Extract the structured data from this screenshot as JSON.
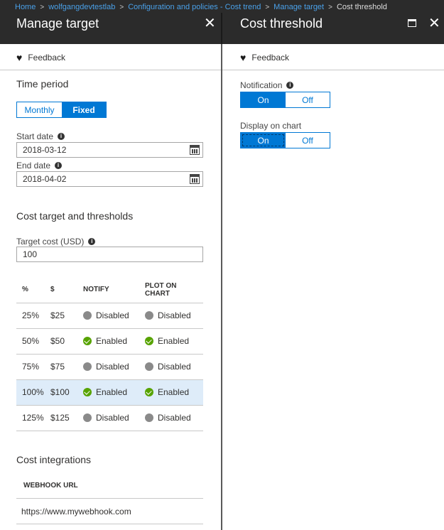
{
  "breadcrumb": {
    "items": [
      "Home",
      "wolfgangdevtestlab",
      "Configuration and policies - Cost trend",
      "Manage target"
    ],
    "current": "Cost threshold",
    "separator": ">"
  },
  "left_blade": {
    "title": "Manage target",
    "close_glyph": "✕",
    "feedback_label": "Feedback",
    "time_period": {
      "heading": "Time period",
      "options": [
        "Monthly",
        "Fixed"
      ],
      "selected": "Fixed"
    },
    "start_date": {
      "label": "Start date",
      "value": "2018-03-12"
    },
    "end_date": {
      "label": "End date",
      "value": "2018-04-02"
    },
    "cost_section_heading": "Cost target and thresholds",
    "target_cost": {
      "label": "Target cost (USD)",
      "value": "100"
    },
    "thresholds_table": {
      "columns": [
        "%",
        "$",
        "NOTIFY",
        "PLOT ON CHART"
      ],
      "rows": [
        {
          "pct": "25%",
          "amount": "$25",
          "notify": "Disabled",
          "plot": "Disabled",
          "selected": false
        },
        {
          "pct": "50%",
          "amount": "$50",
          "notify": "Enabled",
          "plot": "Enabled",
          "selected": false
        },
        {
          "pct": "75%",
          "amount": "$75",
          "notify": "Disabled",
          "plot": "Disabled",
          "selected": false
        },
        {
          "pct": "100%",
          "amount": "$100",
          "notify": "Enabled",
          "plot": "Enabled",
          "selected": true
        },
        {
          "pct": "125%",
          "amount": "$125",
          "notify": "Disabled",
          "plot": "Disabled",
          "selected": false
        }
      ]
    },
    "integrations": {
      "heading": "Cost integrations",
      "column": "WEBHOOK URL",
      "url": "https://www.mywebhook.com"
    }
  },
  "right_blade": {
    "title": "Cost threshold",
    "close_glyph": "✕",
    "feedback_label": "Feedback",
    "notification": {
      "label": "Notification",
      "options": [
        "On",
        "Off"
      ],
      "selected": "On"
    },
    "display_on_chart": {
      "label": "Display on chart",
      "options": [
        "On",
        "Off"
      ],
      "selected": "On"
    }
  },
  "colors": {
    "accent": "#0078d4",
    "enabled": "#57a300",
    "disabled": "#8a8a8a",
    "selected_row": "#deecf9",
    "header_bg": "#2b2b2b"
  }
}
